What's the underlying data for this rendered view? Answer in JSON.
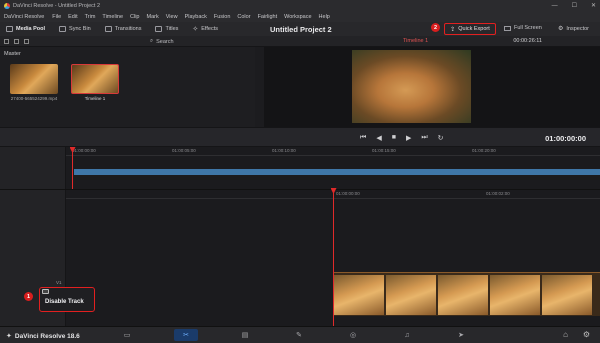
{
  "window": {
    "title": "DaVinci Resolve - Untitled Project 2",
    "controls": [
      "—",
      "☐",
      "✕"
    ]
  },
  "menu": {
    "items": [
      "DaVinci Resolve",
      "File",
      "Edit",
      "Trim",
      "Timeline",
      "Clip",
      "Mark",
      "View",
      "Playback",
      "Fusion",
      "Color",
      "Fairlight",
      "Workspace",
      "Help"
    ]
  },
  "toolbar": {
    "media_pool": "Media Pool",
    "sync_bin": "Sync Bin",
    "transitions": "Transitions",
    "titles": "Titles",
    "effects": "Effects",
    "project_title": "Untitled Project 2",
    "quick_export": "Quick Export",
    "full_screen": "Full Screen",
    "inspector": "Inspector",
    "step_badge": "2"
  },
  "media_pool": {
    "search_label": "Search",
    "bin_label": "Master",
    "clips": [
      {
        "name": "27400-565524299.mp4",
        "selected": false
      },
      {
        "name": "Timeline 1",
        "selected": true
      }
    ]
  },
  "viewer": {
    "timeline_name": "Timeline 1",
    "timecode_top": "00:00:26:11"
  },
  "transport": {
    "timecode": "01:00:00:00"
  },
  "timeline": {
    "upper_ruler": [
      "01:00:00:00",
      "01:00:05:00",
      "01:00:10:00",
      "01:00:15:00",
      "01:00:20:00"
    ],
    "lower_ruler": [
      "01:00:00:00",
      "01:00:02:00"
    ],
    "track_label": "V1",
    "disable_track": "Disable Track",
    "step_badge": "1"
  },
  "status": {
    "app_name": "DaVinci Resolve 18.6"
  },
  "colors": {
    "accent_red": "#e22020",
    "timeline_blue": "#3f77a8",
    "playhead": "#e02a2a"
  }
}
